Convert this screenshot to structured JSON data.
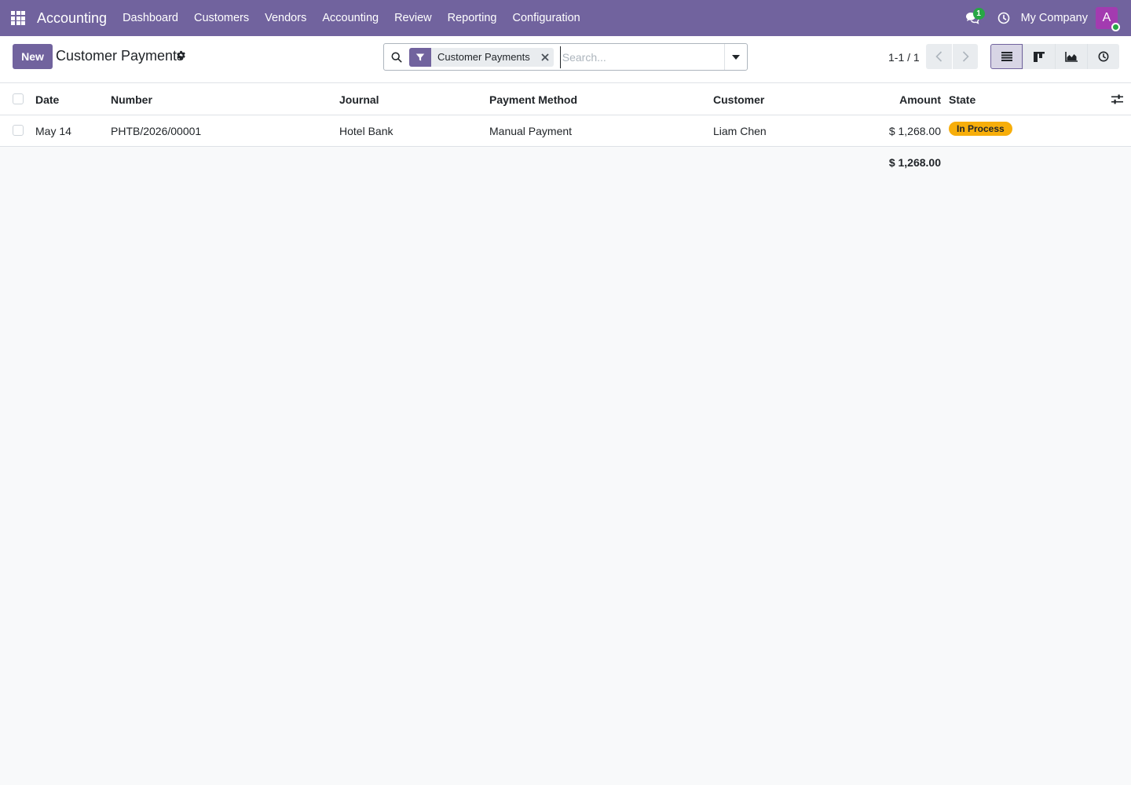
{
  "app": {
    "name": "Accounting",
    "menu": [
      "Dashboard",
      "Customers",
      "Vendors",
      "Accounting",
      "Review",
      "Reporting",
      "Configuration"
    ],
    "chat_count": "1",
    "company": "My Company",
    "avatar_letter": "A"
  },
  "control": {
    "new_label": "New",
    "title": "Customer Payments",
    "facet_label": "Customer Payments",
    "search_placeholder": "Search...",
    "pager": "1-1 / 1"
  },
  "table": {
    "columns": {
      "date": "Date",
      "number": "Number",
      "journal": "Journal",
      "method": "Payment Method",
      "customer": "Customer",
      "amount": "Amount",
      "state": "State"
    },
    "rows": [
      {
        "date": "May 14",
        "number": "PHTB/2026/00001",
        "journal": "Hotel Bank",
        "method": "Manual Payment",
        "customer": "Liam Chen",
        "amount": "$ 1,268.00",
        "state": "In Process"
      }
    ],
    "total": "$ 1,268.00"
  },
  "colors": {
    "brand": "#71639e",
    "state_in_process": "#f7ae0a",
    "online": "#28a745"
  }
}
